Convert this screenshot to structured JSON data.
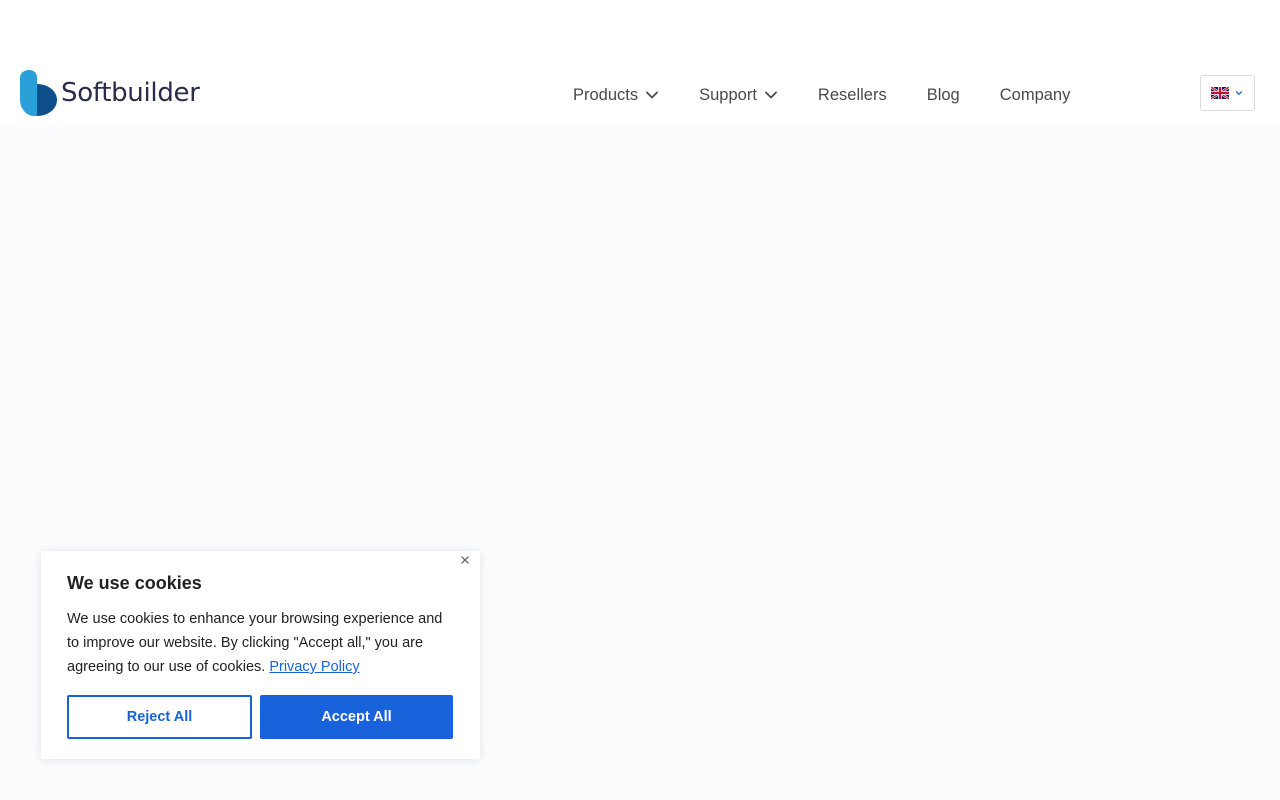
{
  "brand": {
    "name": "Softbuilder",
    "logo_icon": "softbuilder-logo-icon"
  },
  "nav": {
    "items": [
      {
        "label": "Products",
        "has_dropdown": true
      },
      {
        "label": "Support",
        "has_dropdown": true
      },
      {
        "label": "Resellers",
        "has_dropdown": false
      },
      {
        "label": "Blog",
        "has_dropdown": false
      },
      {
        "label": "Company",
        "has_dropdown": false
      }
    ]
  },
  "language": {
    "selected_icon": "uk-flag-icon"
  },
  "cookie_banner": {
    "title": "We use cookies",
    "text": "We use cookies to enhance your browsing experience and to improve our website. By clicking \"Accept all,\" you are agreeing to our use of cookies.",
    "policy_link": "Privacy Policy",
    "reject_label": "Reject All",
    "accept_label": "Accept All"
  },
  "colors": {
    "accent": "#1863dc",
    "logo_blue_dark": "#0d5fa0",
    "logo_blue_light": "#2a9fd8",
    "text_dark": "#212121",
    "nav_text": "#4a4a4a",
    "content_bg": "#fbfcfe"
  }
}
